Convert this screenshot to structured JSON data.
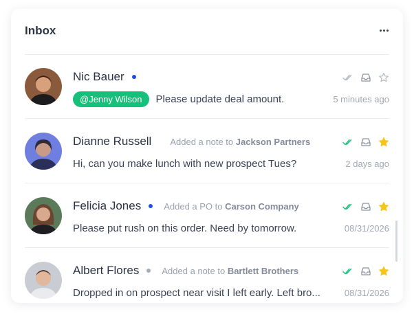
{
  "inbox": {
    "title": "Inbox",
    "more_icon": "more-horizontal-icon",
    "colors": {
      "unread_dot": "#1d4ee6",
      "read_dot": "#a6abb8",
      "mention_bg": "#17c07a",
      "check_read": "#17c07a",
      "check_unread": "#b4b9c4",
      "star_active": "#f5c518",
      "star_inactive": "#b4b9c4"
    },
    "messages": [
      {
        "name": "Nic Bauer",
        "unread": true,
        "activity_prefix": "",
        "activity_target": "",
        "mention": "@Jenny Wilson",
        "text": "Please update deal amount.",
        "time": "5 minutes ago",
        "checked": false,
        "starred": false
      },
      {
        "name": "Dianne Russell",
        "unread": false,
        "activity_prefix": "Added a note to",
        "activity_target": "Jackson Partners",
        "mention": "",
        "text": "Hi, can you make lunch with new prospect Tues?",
        "time": "2 days ago",
        "checked": true,
        "starred": true
      },
      {
        "name": "Felicia Jones",
        "unread": true,
        "activity_prefix": "Added a PO to",
        "activity_target": "Carson Company",
        "mention": "",
        "text": "Please put rush on this order. Need by tomorrow.",
        "time": "08/31/2026",
        "checked": true,
        "starred": true
      },
      {
        "name": "Albert Flores",
        "unread": false,
        "activity_prefix": "Added a note to",
        "activity_target": "Bartlett Brothers",
        "mention": "",
        "text": "Dropped in on prospect near visit I left early. Left bro...",
        "time": "08/31/2026",
        "checked": true,
        "starred": true
      }
    ]
  }
}
